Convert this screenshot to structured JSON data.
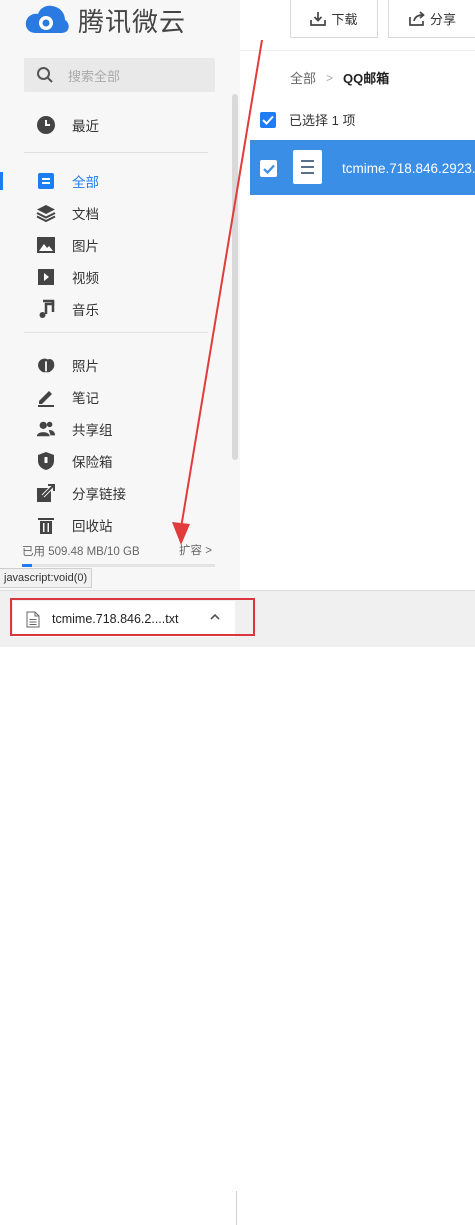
{
  "app": {
    "title": "腾讯微云"
  },
  "search": {
    "placeholder": "搜索全部"
  },
  "nav_group1": [
    {
      "label": "最近",
      "icon": "clock-icon"
    }
  ],
  "nav_group2": [
    {
      "label": "全部",
      "icon": "all-files-icon",
      "active": true
    },
    {
      "label": "文档",
      "icon": "layers-icon"
    },
    {
      "label": "图片",
      "icon": "image-icon"
    },
    {
      "label": "视频",
      "icon": "video-icon"
    },
    {
      "label": "音乐",
      "icon": "music-icon"
    }
  ],
  "nav_group3": [
    {
      "label": "照片",
      "icon": "photo-icon"
    },
    {
      "label": "笔记",
      "icon": "pencil-icon"
    },
    {
      "label": "共享组",
      "icon": "group-icon"
    },
    {
      "label": "保险箱",
      "icon": "shield-icon"
    },
    {
      "label": "分享链接",
      "icon": "share-link-icon"
    },
    {
      "label": "回收站",
      "icon": "trash-icon"
    }
  ],
  "storage": {
    "used": "已用 509.48 MB/10 GB",
    "expand": "扩容 >",
    "used_fraction": 0.05
  },
  "toolbar": {
    "download_label": "下载",
    "share_label": "分享"
  },
  "breadcrumb": {
    "root": "全部",
    "separator": ">",
    "current": "QQ邮箱"
  },
  "selection": {
    "text": "已选择 1 项"
  },
  "file": {
    "name": "tcmime.718.846.2923."
  },
  "status_bar": {
    "text": "javascript:void(0)"
  },
  "download": {
    "filename": "tcmime.718.846.2....txt"
  },
  "colors": {
    "accent": "#1e7cf5",
    "selected_row": "#3a8ee6",
    "annotation": "#d9363e"
  }
}
